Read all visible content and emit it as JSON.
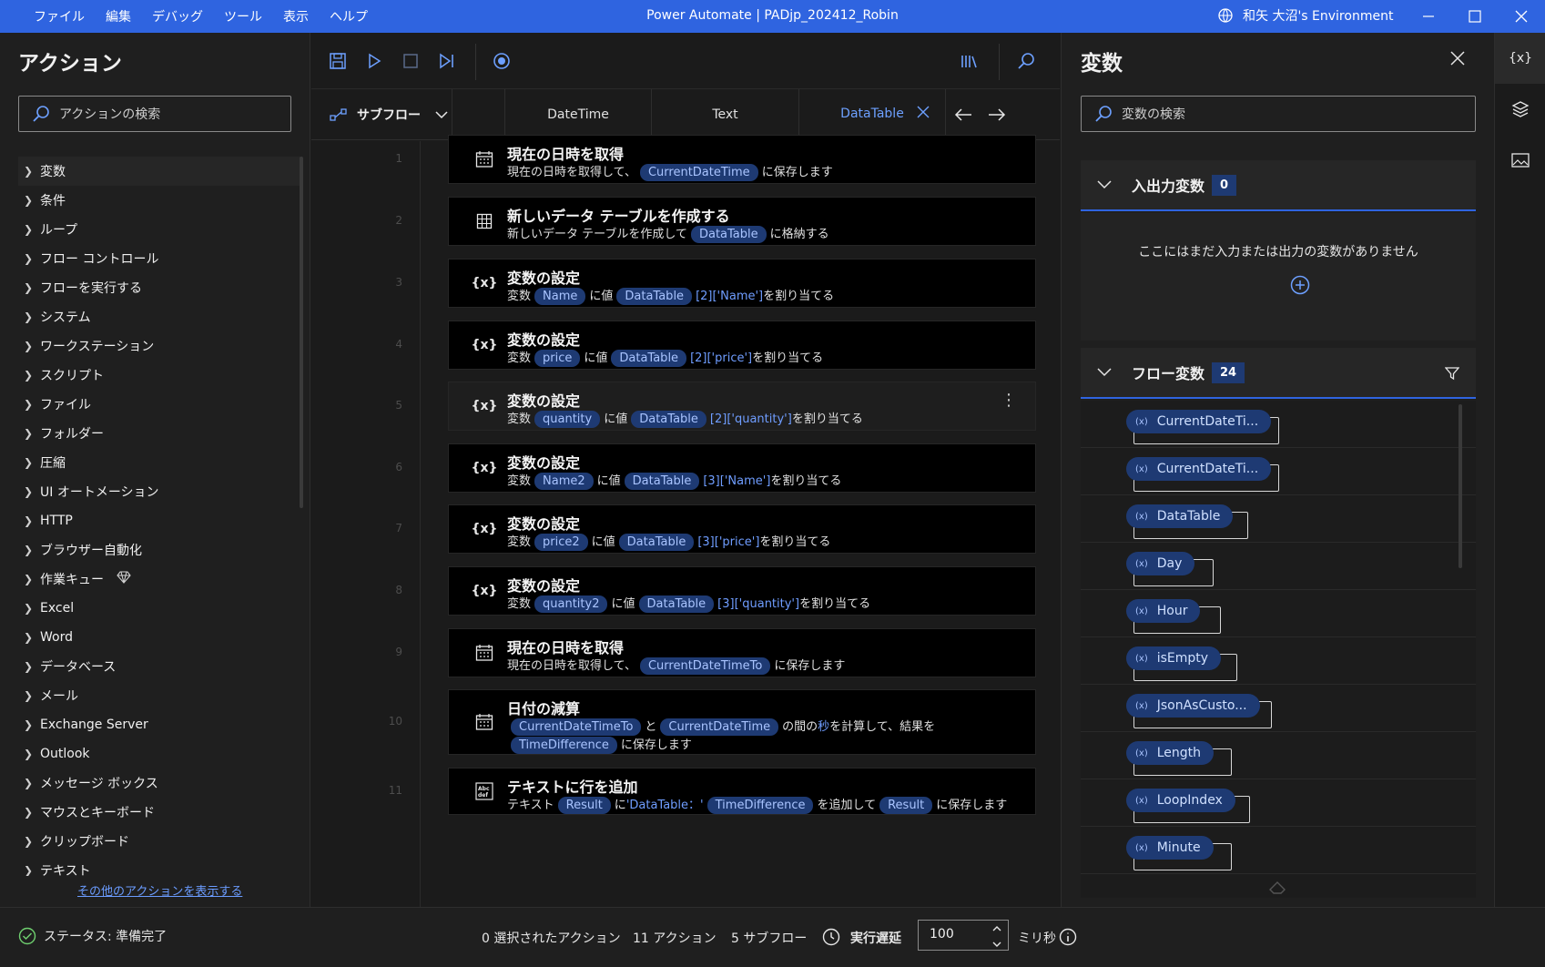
{
  "menu": [
    "ファイル",
    "編集",
    "デバッグ",
    "ツール",
    "表示",
    "ヘルプ"
  ],
  "window_title": "Power Automate | PADjp_202412_Robin",
  "environment": "和矢 大沼's Environment",
  "actions_panel": {
    "title": "アクション",
    "search_placeholder": "アクションの検索",
    "items": [
      "変数",
      "条件",
      "ループ",
      "フロー コントロール",
      "フローを実行する",
      "システム",
      "ワークステーション",
      "スクリプト",
      "ファイル",
      "フォルダー",
      "圧縮",
      "UI オートメーション",
      "HTTP",
      "ブラウザー自動化",
      "作業キュー",
      "Excel",
      "Word",
      "データベース",
      "メール",
      "Exchange Server",
      "Outlook",
      "メッセージ ボックス",
      "マウスとキーボード",
      "クリップボード",
      "テキスト"
    ],
    "more_link": "その他のアクションを表示する"
  },
  "editor": {
    "subflow_label": "サブフロー",
    "tabs": [
      "DateTime",
      "Text",
      "DataTable"
    ],
    "active_tab": "DataTable",
    "steps": [
      {
        "n": "1",
        "title": "現在の日時を取得",
        "icon": "calendar-icon",
        "desc": [
          "現在の日時を取得して、",
          "CurrentDateTime",
          "に保存します"
        ]
      },
      {
        "n": "2",
        "title": "新しいデータ テーブルを作成する",
        "icon": "table-icon",
        "desc": [
          "新しいデータ テーブルを作成して",
          "DataTable",
          "に格納する"
        ]
      },
      {
        "n": "3",
        "title": "変数の設定",
        "icon": "variable-icon",
        "desc": [
          "変数",
          "Name",
          "に値",
          "DataTable",
          "[2]['Name']",
          "を割り当てる"
        ]
      },
      {
        "n": "4",
        "title": "変数の設定",
        "icon": "variable-icon",
        "desc": [
          "変数",
          "price",
          "に値",
          "DataTable",
          "[2]['price']",
          "を割り当てる"
        ]
      },
      {
        "n": "5",
        "title": "変数の設定",
        "icon": "variable-icon",
        "desc": [
          "変数",
          "quantity",
          "に値",
          "DataTable",
          "[2]['quantity']",
          "を割り当てる"
        ]
      },
      {
        "n": "6",
        "title": "変数の設定",
        "icon": "variable-icon",
        "desc": [
          "変数",
          "Name2",
          "に値",
          "DataTable",
          "[3]['Name']",
          "を割り当てる"
        ]
      },
      {
        "n": "7",
        "title": "変数の設定",
        "icon": "variable-icon",
        "desc": [
          "変数",
          "price2",
          "に値",
          "DataTable",
          "[3]['price']",
          "を割り当てる"
        ]
      },
      {
        "n": "8",
        "title": "変数の設定",
        "icon": "variable-icon",
        "desc": [
          "変数",
          "quantity2",
          "に値",
          "DataTable",
          "[3]['quantity']",
          "を割り当てる"
        ]
      },
      {
        "n": "9",
        "title": "現在の日時を取得",
        "icon": "calendar-icon",
        "desc": [
          "現在の日時を取得して、",
          "CurrentDateTimeTo",
          "に保存します"
        ]
      },
      {
        "n": "10",
        "title": "日付の減算",
        "icon": "calendar-icon",
        "desc": [
          "CurrentDateTimeTo",
          "と",
          "CurrentDateTime",
          "の間の",
          "秒",
          "を計算して、結果を",
          "TimeDifference",
          "に保存します"
        ]
      },
      {
        "n": "11",
        "title": "テキストに行を追加",
        "icon": "text-icon",
        "desc": [
          "テキスト",
          "Result",
          "に",
          "'DataTable：'",
          "TimeDifference",
          "を追加して",
          "Result",
          "に保存します"
        ]
      }
    ]
  },
  "variables_panel": {
    "title": "変数",
    "search_placeholder": "変数の検索",
    "io_label": "入出力変数",
    "io_count": "0",
    "io_empty": "ここにはまだ入力または出力の変数がありません",
    "flow_label": "フロー変数",
    "flow_count": "24",
    "flow_vars": [
      "CurrentDateTi...",
      "CurrentDateTi...",
      "DataTable",
      "Day",
      "Hour",
      "isEmpty",
      "JsonAsCusto...",
      "Length",
      "LoopIndex",
      "Minute"
    ]
  },
  "status": {
    "text": "ステータス: 準備完了",
    "selected": "0 選択されたアクション",
    "actions": "11 アクション",
    "subflows": "5 サブフロー",
    "delay_label": "実行遅延",
    "delay_value": "100",
    "unit": "ミリ秒"
  },
  "colors": {
    "titlebar": "#2f64e0",
    "chip": "#1e3a73",
    "accent": "#6da0ff"
  }
}
